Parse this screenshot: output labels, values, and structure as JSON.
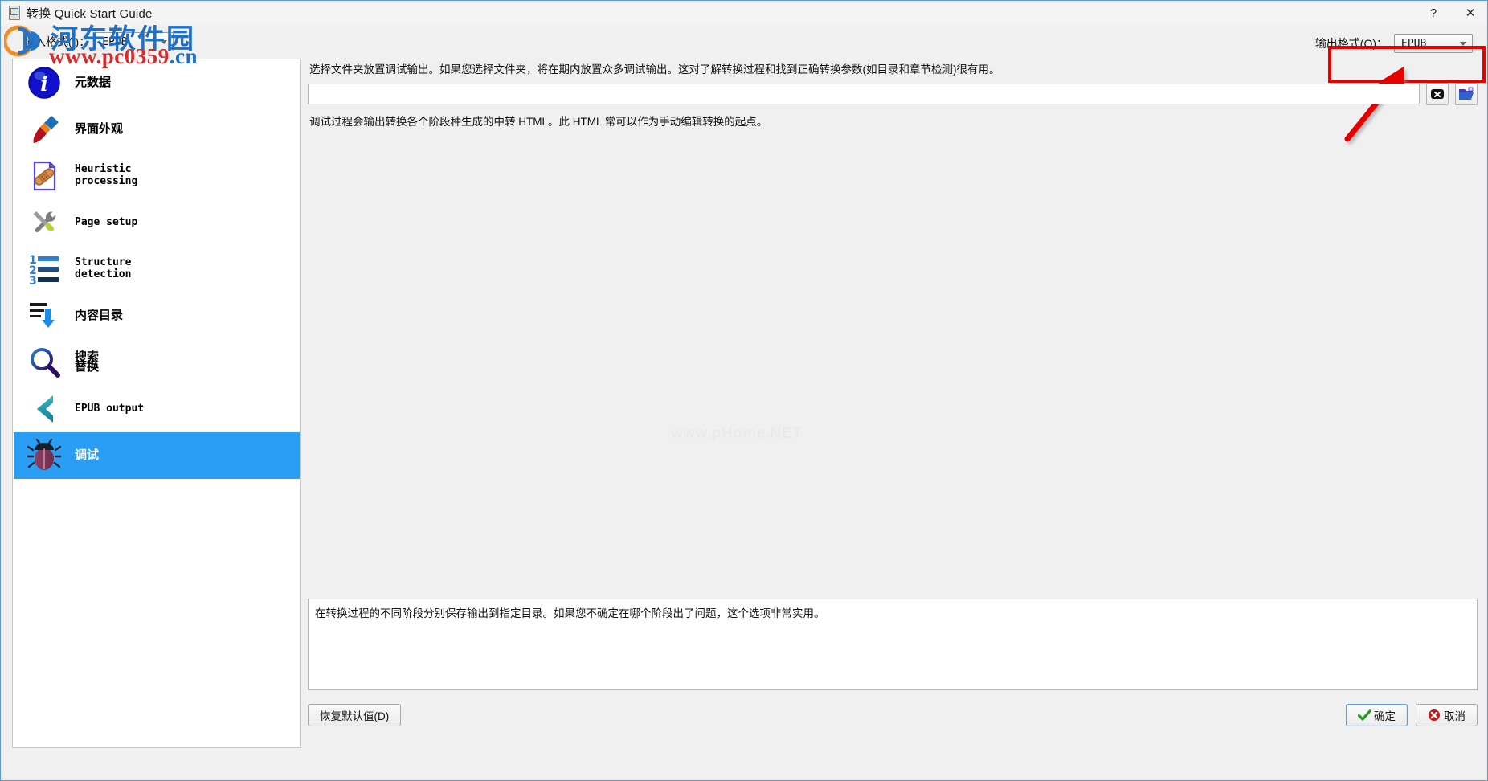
{
  "window": {
    "title": "转换 Quick Start Guide",
    "app_icon": "book-icon",
    "help_label": "?",
    "close_label": "✕"
  },
  "topbar": {
    "input_format": {
      "label_prefix": "输入格式(",
      "label_key": "I",
      "label_suffix": "）：",
      "label_full": "输入格式(I)：",
      "value": "EPUB"
    },
    "output_format": {
      "label_full": "输出格式(O)：",
      "value": "EPUB"
    },
    "annotation": {
      "highlight_color": "#e60000",
      "arrow_color": "#e60000",
      "arrow_points_to": "output-format-combo"
    }
  },
  "sidebar": {
    "items": [
      {
        "label": "元数据",
        "icon": "info-icon",
        "style": "cjk",
        "selected": false
      },
      {
        "label": "界面外观",
        "icon": "paintbrush-icon",
        "style": "cjk",
        "selected": false
      },
      {
        "label": "Heuristic\nprocessing",
        "icon": "document-bandaid-icon",
        "style": "mono",
        "selected": false
      },
      {
        "label": "Page setup",
        "icon": "wrench-screwdriver-icon",
        "style": "mono",
        "selected": false
      },
      {
        "label": "Structure\ndetection",
        "icon": "numbered-list-icon",
        "style": "mono",
        "selected": false
      },
      {
        "label": "内容目录",
        "icon": "table-of-contents-icon",
        "style": "cjk",
        "selected": false
      },
      {
        "label": "搜索\n替换",
        "icon": "magnifier-icon",
        "style": "stacked",
        "selected": false
      },
      {
        "label": "EPUB output",
        "icon": "chevron-left-icon",
        "style": "mono",
        "selected": false
      },
      {
        "label": "调试",
        "icon": "bug-icon",
        "style": "cjk",
        "selected": true
      }
    ],
    "selected_color": "#2a9df4"
  },
  "main": {
    "description_top": "选择文件夹放置调试输出。如果您选择文件夹，将在期内放置众多调试输出。这对了解转换过程和找到正确转换参数(如目录和章节检测)很有用。",
    "path_input": {
      "value": "",
      "placeholder": ""
    },
    "clear_button_icon": "clear-x-icon",
    "browse_button_icon": "open-folder-icon",
    "description_mid": "调试过程会输出转换各个阶段种生成的中转 HTML。此 HTML 常可以作为手动编辑转换的起点。",
    "description_bottom": "在转换过程的不同阶段分别保存输出到指定目录。如果您不确定在哪个阶段出了问题，这个选项非常实用。",
    "center_watermark": "www.pHome.NET"
  },
  "footer": {
    "restore_defaults": "恢复默认值(D)",
    "ok": "确定",
    "cancel": "取消",
    "ok_icon": "green-check-icon",
    "cancel_icon": "red-x-icon"
  },
  "watermark": {
    "site_name": "河东软件园",
    "url_main": "www.pc0359",
    "url_tld": ".cn",
    "logo": "hedong-logo-icon"
  }
}
